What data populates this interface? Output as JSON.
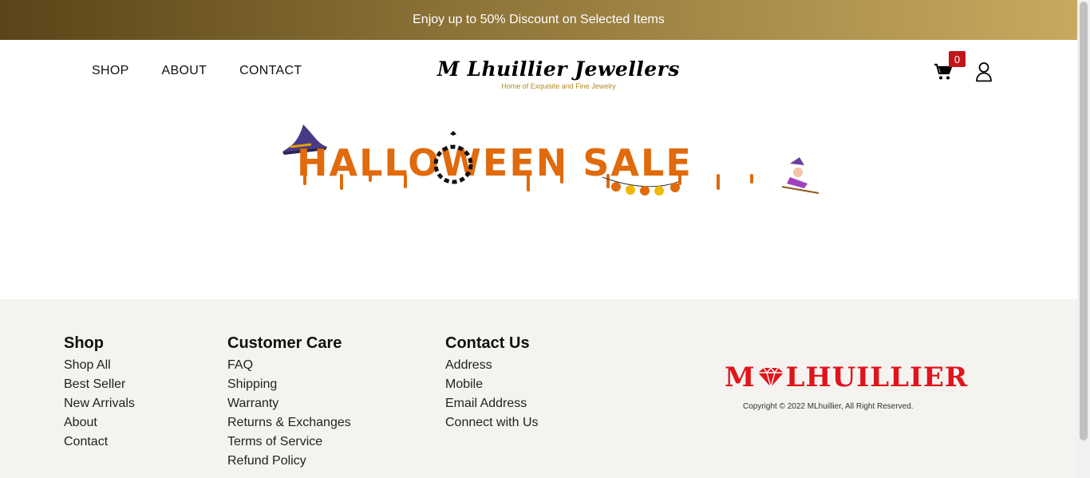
{
  "promo": {
    "text": "Enjoy up to 50% Discount on Selected Items"
  },
  "nav": {
    "items": [
      "SHOP",
      "ABOUT",
      "CONTACT"
    ]
  },
  "logo": {
    "name": "M Lhuillier Jewellers",
    "tagline": "Home of Exquisite and Fine Jewelry"
  },
  "cart": {
    "count": "0"
  },
  "banner": {
    "text": "HALLOWEEN SALE"
  },
  "footer": {
    "shop": {
      "title": "Shop",
      "links": [
        "Shop All",
        "Best Seller",
        "New Arrivals",
        "About",
        "Contact"
      ]
    },
    "care": {
      "title": "Customer Care",
      "links": [
        "FAQ",
        "Shipping",
        "Warranty",
        "Returns & Exchanges",
        "Terms of Service",
        "Refund Policy"
      ]
    },
    "contact": {
      "title": "Contact Us",
      "links": [
        "Address",
        "Mobile",
        "Email Address",
        "Connect with Us"
      ]
    },
    "brand": {
      "name_left": "M",
      "name_right": "LHUILLIER"
    },
    "copyright": "Copyright © 2022 MLhuillier, All Right Reserved."
  },
  "colors": {
    "accent_gold": "#b28a1e",
    "brand_red": "#e0141b",
    "sale_orange": "#e06a0c"
  },
  "icons": [
    "cart-icon",
    "user-icon",
    "diamond-icon"
  ]
}
